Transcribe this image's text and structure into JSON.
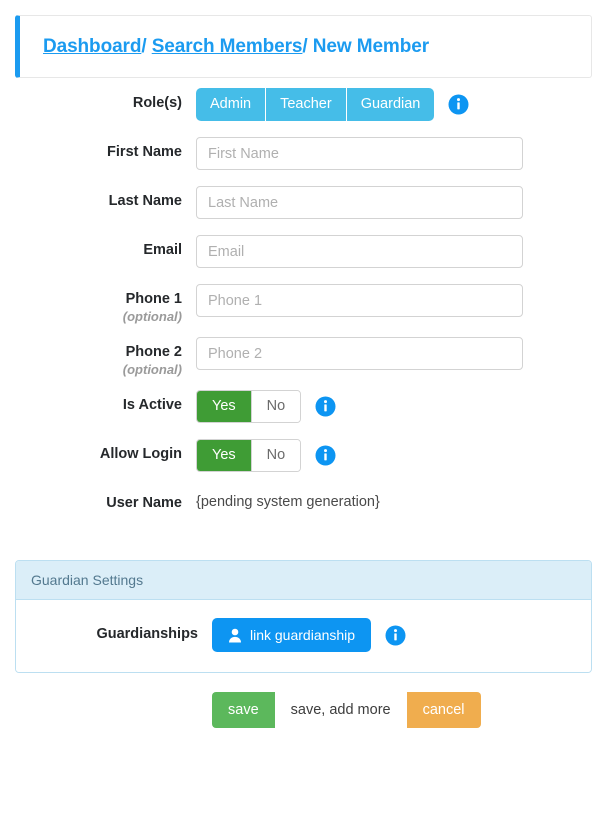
{
  "breadcrumb": {
    "dashboard": "Dashboard",
    "search_members": "Search Members",
    "current": "New Member",
    "separator": "/"
  },
  "form": {
    "roles": {
      "label": "Role(s)",
      "options": [
        "Admin",
        "Teacher",
        "Guardian"
      ],
      "info_icon": "info-icon"
    },
    "first_name": {
      "label": "First Name",
      "value": "",
      "placeholder": "First Name"
    },
    "last_name": {
      "label": "Last Name",
      "value": "",
      "placeholder": "Last Name"
    },
    "email": {
      "label": "Email",
      "value": "",
      "placeholder": "Email"
    },
    "phone1": {
      "label": "Phone 1",
      "sublabel": "(optional)",
      "value": "",
      "placeholder": "Phone 1"
    },
    "phone2": {
      "label": "Phone 2",
      "sublabel": "(optional)",
      "value": "",
      "placeholder": "Phone 2"
    },
    "is_active": {
      "label": "Is Active",
      "yes": "Yes",
      "no": "No",
      "selected": "Yes"
    },
    "allow_login": {
      "label": "Allow Login",
      "yes": "Yes",
      "no": "No",
      "selected": "Yes"
    },
    "user_name": {
      "label": "User Name",
      "value": "{pending system generation}"
    }
  },
  "guardian_panel": {
    "title": "Guardian Settings",
    "guardianships": {
      "label": "Guardianships",
      "button_label": "link guardianship",
      "button_icon": "person-icon"
    }
  },
  "actions": {
    "save": "save",
    "save_add_more": "save, add more",
    "cancel": "cancel"
  },
  "colors": {
    "accent_blue": "#1b9bf0",
    "role_blue": "#45bde8",
    "link_blue": "#0d95f2",
    "toggle_green": "#3f9c35",
    "save_green": "#5cb85c",
    "cancel_orange": "#f0ad4e",
    "panel_header": "#dbeef8"
  }
}
